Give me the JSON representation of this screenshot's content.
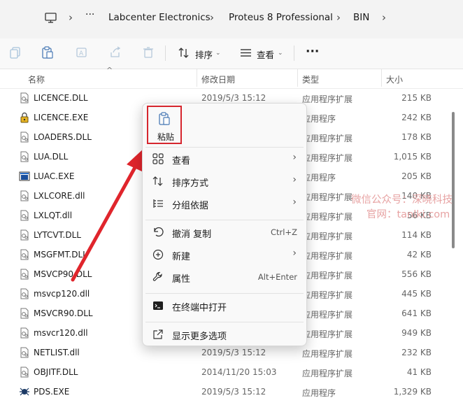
{
  "address_bar": {
    "crumbs": [
      "Labcenter Electronics",
      "Proteus 8 Professional",
      "BIN"
    ]
  },
  "toolbar": {
    "sort_label": "排序",
    "view_label": "查看"
  },
  "columns": {
    "name": "名称",
    "date": "修改日期",
    "type": "类型",
    "size": "大小"
  },
  "files": [
    {
      "name": "LICENCE.DLL",
      "date": "2019/5/3 15:12",
      "type": "应用程序扩展",
      "size": "215 KB",
      "icon": "dll-icon"
    },
    {
      "name": "LICENCE.EXE",
      "date": "",
      "type": "应用程序",
      "size": "242 KB",
      "icon": "exe-lock-icon"
    },
    {
      "name": "LOADERS.DLL",
      "date": "",
      "type": "应用程序扩展",
      "size": "178 KB",
      "icon": "dll-icon"
    },
    {
      "name": "LUA.DLL",
      "date": "",
      "type": "应用程序扩展",
      "size": "1,015 KB",
      "icon": "dll-icon"
    },
    {
      "name": "LUAC.EXE",
      "date": "",
      "type": "应用程序",
      "size": "205 KB",
      "icon": "exe-window-icon"
    },
    {
      "name": "LXLCORE.dll",
      "date": "",
      "type": "应用程序扩展",
      "size": "140 KB",
      "icon": "dll-icon"
    },
    {
      "name": "LXLQT.dll",
      "date": "",
      "type": "应用程序扩展",
      "size": "56 KB",
      "icon": "dll-icon"
    },
    {
      "name": "LYTCVT.DLL",
      "date": "",
      "type": "应用程序扩展",
      "size": "114 KB",
      "icon": "dll-icon"
    },
    {
      "name": "MSGFMT.DLL",
      "date": "",
      "type": "应用程序扩展",
      "size": "42 KB",
      "icon": "dll-icon"
    },
    {
      "name": "MSVCP90.DLL",
      "date": "",
      "type": "应用程序扩展",
      "size": "556 KB",
      "icon": "dll-icon"
    },
    {
      "name": "msvcp120.dll",
      "date": "",
      "type": "应用程序扩展",
      "size": "445 KB",
      "icon": "dll-icon"
    },
    {
      "name": "MSVCR90.DLL",
      "date": "",
      "type": "应用程序扩展",
      "size": "641 KB",
      "icon": "dll-icon"
    },
    {
      "name": "msvcr120.dll",
      "date": "",
      "type": "应用程序扩展",
      "size": "949 KB",
      "icon": "dll-icon"
    },
    {
      "name": "NETLIST.dll",
      "date": "2019/5/3 15:12",
      "type": "应用程序扩展",
      "size": "232 KB",
      "icon": "dll-icon"
    },
    {
      "name": "OBJITF.DLL",
      "date": "2014/11/20 15:03",
      "type": "应用程序扩展",
      "size": "41 KB",
      "icon": "dll-icon"
    },
    {
      "name": "PDS.EXE",
      "date": "2019/5/3 15:12",
      "type": "应用程序",
      "size": "1,329 KB",
      "icon": "exe-bug-icon"
    }
  ],
  "context_menu": {
    "paste_label": "粘贴",
    "items": [
      {
        "label": "查看",
        "shortcut": "",
        "submenu": true
      },
      {
        "label": "排序方式",
        "shortcut": "",
        "submenu": true
      },
      {
        "label": "分组依据",
        "shortcut": "",
        "submenu": true
      },
      {
        "label": "撤消 复制",
        "shortcut": "Ctrl+Z",
        "submenu": false
      },
      {
        "label": "新建",
        "shortcut": "",
        "submenu": true
      },
      {
        "label": "属性",
        "shortcut": "Alt+Enter",
        "submenu": false
      },
      {
        "label": "在终端中打开",
        "shortcut": "",
        "submenu": false
      },
      {
        "label": "显示更多选项",
        "shortcut": "",
        "submenu": false
      }
    ]
  },
  "watermark": {
    "line1": "微信公众号：深晓科技",
    "line2": "官网：tanlki.com"
  },
  "colors": {
    "accent_red": "#d6262e",
    "arrow_red": "#e0252c"
  }
}
